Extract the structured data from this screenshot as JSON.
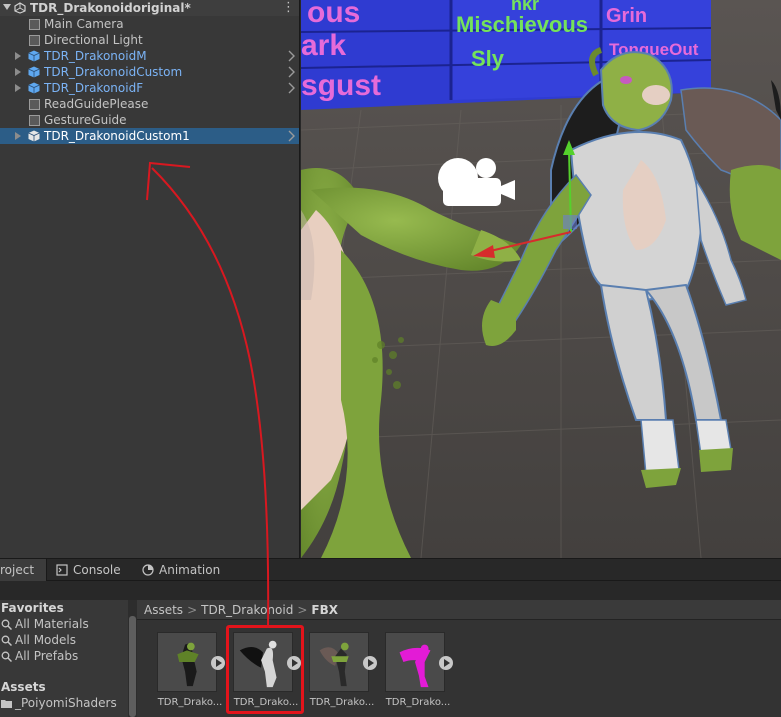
{
  "hierarchy": {
    "scene_name": "TDR_Drakonoidoriginal*",
    "menu_glyph": "⋮",
    "items": [
      {
        "label": "Main Camera",
        "kind": "gameobject",
        "expandable": false,
        "selected": false
      },
      {
        "label": "Directional Light",
        "kind": "gameobject",
        "expandable": false,
        "selected": false
      },
      {
        "label": "TDR_DrakonoidM",
        "kind": "prefab",
        "expandable": true,
        "selected": false
      },
      {
        "label": "TDR_DrakonoidCustom",
        "kind": "prefab",
        "expandable": true,
        "selected": false
      },
      {
        "label": "TDR_DrakonoidF",
        "kind": "prefab",
        "expandable": true,
        "selected": false
      },
      {
        "label": "ReadGuidePlease",
        "kind": "gameobject",
        "expandable": false,
        "selected": false
      },
      {
        "label": "GestureGuide",
        "kind": "gameobject",
        "expandable": false,
        "selected": false
      },
      {
        "label": "TDR_DrakonoidCustom1",
        "kind": "prefab-white",
        "expandable": true,
        "selected": true
      }
    ]
  },
  "scene_view": {
    "banner_words": [
      "ous",
      "Mischievous",
      "Grin",
      "ark",
      "Sly",
      "TongueOut",
      "sgust",
      "nkr"
    ]
  },
  "tabs": [
    {
      "label": "roject",
      "icon": "folder-icon",
      "active": true
    },
    {
      "label": "Console",
      "icon": "console-icon",
      "active": false
    },
    {
      "label": "Animation",
      "icon": "animation-icon",
      "active": false
    }
  ],
  "project": {
    "favorites_header": "Favorites",
    "favorites": [
      "All Materials",
      "All Models",
      "All Prefabs"
    ],
    "assets_header": "Assets",
    "asset_folders": [
      "_PoiyomiShaders"
    ],
    "breadcrumb": [
      "Assets",
      "TDR_Drakonoid",
      "FBX"
    ],
    "breadcrumb_sep": ">",
    "files": [
      {
        "label": "TDR_Drako...",
        "variant": "green-dark"
      },
      {
        "label": "TDR_Drako...",
        "variant": "white-wings",
        "highlighted": true
      },
      {
        "label": "TDR_Drako...",
        "variant": "green-light"
      },
      {
        "label": "TDR_Drako...",
        "variant": "magenta"
      }
    ]
  },
  "colors": {
    "selection": "#2c5d87",
    "prefab_text": "#7bb3f5",
    "annotation_red": "#e3141b",
    "dragon_green": "#7ea33c",
    "panel_bg": "#383838"
  }
}
